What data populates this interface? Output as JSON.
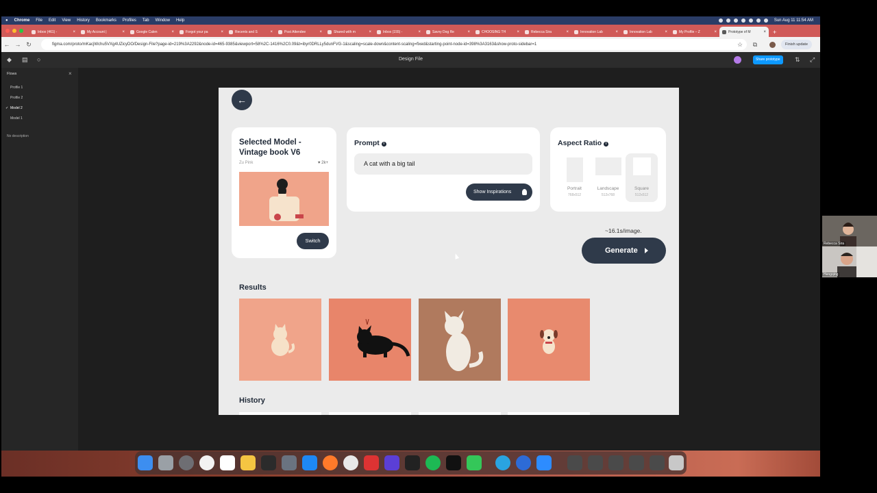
{
  "menubar": {
    "app": "Chrome",
    "items": [
      "File",
      "Edit",
      "View",
      "History",
      "Bookmarks",
      "Profiles",
      "Tab",
      "Window",
      "Help"
    ],
    "clock": "Sun Aug 11  11:54 AM"
  },
  "tabs": [
    {
      "label": "Inbox (461) -"
    },
    {
      "label": "My Account |"
    },
    {
      "label": "Google Calen"
    },
    {
      "label": "Forgot your pa"
    },
    {
      "label": "Recents and S"
    },
    {
      "label": "Post Attendee"
    },
    {
      "label": "Shared with m"
    },
    {
      "label": "Inbox (155) -"
    },
    {
      "label": "Savvy Dog Re"
    },
    {
      "label": "CHOOSING TH"
    },
    {
      "label": "Rebecca Sira"
    },
    {
      "label": "Innovation Lab"
    },
    {
      "label": "Innovation Lab"
    },
    {
      "label": "My Profile – Z"
    },
    {
      "label": "Prototype of M"
    }
  ],
  "address": {
    "url": "figma.com/proto/mKacjWchu5VXg4UZicyDO/Design-File?page-id=219%3A2292&node-id=465-9385&viewport=58%2C-1416%2C0.09&t=ibyr0DRLLy5dunFVG-1&scaling=scale-down&content-scaling=fixed&starting-point-node-id=398%3A3163&show-proto-sidebar=1",
    "finish_update": "Finish update"
  },
  "figma": {
    "title": "Design File",
    "share_label": "Share prototype"
  },
  "sidebar": {
    "header": "Flows",
    "flows": [
      {
        "label": "Profile 1",
        "checked": false
      },
      {
        "label": "Profile 2",
        "checked": false
      },
      {
        "label": "Model 2",
        "checked": true
      },
      {
        "label": "Model 1",
        "checked": false
      }
    ],
    "description": "No description"
  },
  "model": {
    "title": "Selected Model - Vintage book V6",
    "author": "Zu Pink",
    "likes": "2k+",
    "switch_label": "Switch"
  },
  "prompt": {
    "title": "Prompt",
    "value": "A cat with a big tail",
    "inspirations_label": "Show Inspirations"
  },
  "aspect": {
    "title": "Aspect Ratio",
    "options": [
      {
        "label": "Portrait",
        "dims": "768x512",
        "selected": false
      },
      {
        "label": "Landscape",
        "dims": "512x768",
        "selected": false
      },
      {
        "label": "Square",
        "dims": "512x512",
        "selected": true
      }
    ]
  },
  "generate": {
    "time_per_image": "~16.1s/image.",
    "label": "Generate"
  },
  "results": {
    "title": "Results"
  },
  "history": {
    "title": "History"
  },
  "participants": [
    {
      "name": "Rebecca Sira"
    },
    {
      "name": "Hengqing"
    }
  ],
  "colors": {
    "accent_dark": "#2f3a4a",
    "frame_bg": "#ebebeb",
    "result_bg_1": "#f0a48a",
    "result_bg_2": "#e8856a",
    "result_bg_3": "#b07a5e",
    "result_bg_4": "#e88a6e"
  }
}
